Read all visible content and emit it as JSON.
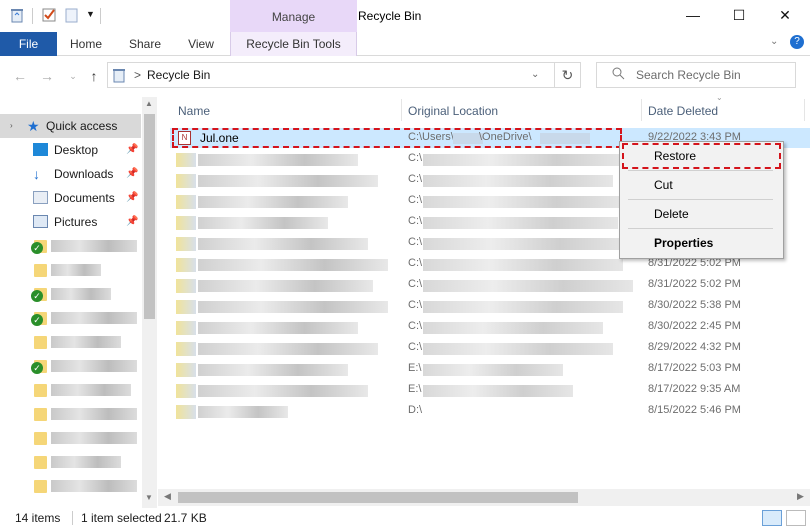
{
  "window": {
    "title": "Recycle Bin",
    "context_tab_group": "Manage",
    "minimize": "—",
    "maximize": "☐",
    "close": "✕"
  },
  "ribbon": {
    "tabs": [
      "File",
      "Home",
      "Share",
      "View",
      "Recycle Bin Tools"
    ]
  },
  "address": {
    "path_sep": ">",
    "location": "Recycle Bin",
    "search_placeholder": "Search Recycle Bin"
  },
  "nav": {
    "quick_access": "Quick access",
    "pinned": [
      "Desktop",
      "Downloads",
      "Documents",
      "Pictures"
    ]
  },
  "columns": {
    "name": "Name",
    "original_location": "Original Location",
    "date_deleted": "Date Deleted"
  },
  "selected_row": {
    "name": "Jul.one",
    "location": "C:\\Users\\",
    "location_mid": "\\OneDrive\\",
    "date": "9/22/2022 3:43 PM"
  },
  "rows": [
    {
      "loc": "C:\\",
      "date": ""
    },
    {
      "loc": "C:\\",
      "date": ""
    },
    {
      "loc": "C:\\",
      "date": ""
    },
    {
      "loc": "C:\\",
      "date": ""
    },
    {
      "loc": "C:\\",
      "date": "8/31/2022 5:02 PM"
    },
    {
      "loc": "C:\\",
      "date": "8/31/2022 5:02 PM"
    },
    {
      "loc": "C:\\",
      "date": "8/30/2022 5:38 PM"
    },
    {
      "loc": "C:\\",
      "date": "8/30/2022 2:45 PM"
    },
    {
      "loc": "C:\\",
      "date": "8/29/2022 4:32 PM"
    },
    {
      "loc": "E:\\",
      "date": "8/17/2022 5:03 PM"
    },
    {
      "loc": "E:\\",
      "date": "8/17/2022 9:35 AM"
    },
    {
      "loc": "D:\\",
      "date": "8/15/2022 5:46 PM"
    }
  ],
  "context_menu": {
    "restore": "Restore",
    "cut": "Cut",
    "delete": "Delete",
    "properties": "Properties"
  },
  "status": {
    "items": "14 items",
    "selected": "1 item selected",
    "size": "21.7 KB"
  },
  "colors": {
    "file_tab": "#1f5aa8",
    "manage_tab": "#e8d8f8",
    "selection": "#cce8ff",
    "highlight_box": "#d4141c"
  }
}
